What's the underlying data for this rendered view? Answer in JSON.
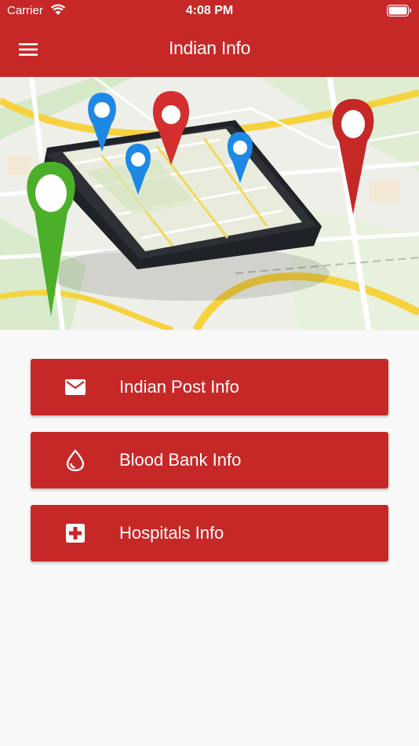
{
  "status_bar": {
    "carrier": "Carrier",
    "time": "4:08 PM"
  },
  "app_bar": {
    "title": "Indian Info"
  },
  "menu": [
    {
      "label": "Indian Post Info",
      "icon": "mail-icon"
    },
    {
      "label": "Blood Bank Info",
      "icon": "blood-drop-icon"
    },
    {
      "label": "Hospitals Info",
      "icon": "hospital-icon"
    }
  ],
  "colors": {
    "primary": "#c62828",
    "background": "#f8f8f8"
  }
}
